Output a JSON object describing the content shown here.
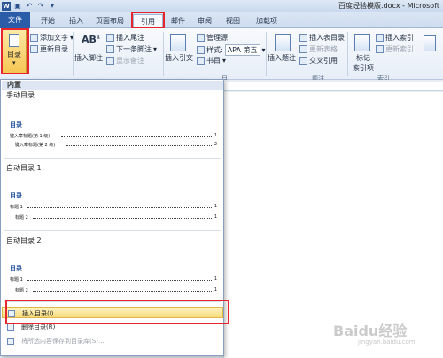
{
  "window": {
    "title": "百度经验模版.docx - Microsoft"
  },
  "tabs": [
    {
      "label": "文件"
    },
    {
      "label": "开始"
    },
    {
      "label": "插入"
    },
    {
      "label": "页面布局"
    },
    {
      "label": "引用"
    },
    {
      "label": "邮件"
    },
    {
      "label": "审阅"
    },
    {
      "label": "视图"
    },
    {
      "label": "加载项"
    }
  ],
  "ribbon": {
    "toc_button": "目录",
    "add_text": "添加文字",
    "update_toc": "更新目录",
    "insert_footnote": "插入脚注",
    "insert_endnote": "插入尾注",
    "next_footnote": "下一条脚注",
    "show_notes": "显示备注",
    "insert_citation": "插入引文",
    "manage_sources": "管理源",
    "style_label": "样式:",
    "style_value": "APA 第五",
    "bibliography": "书目",
    "insert_caption": "插入题注",
    "insert_table_of_figures": "插入表目录",
    "update_table": "更新表格",
    "cross_reference": "交叉引用",
    "mark_entry": "标记",
    "mark_entry_line2": "索引项",
    "insert_index": "插入索引",
    "update_index": "更新索引",
    "groups": {
      "toc": "目",
      "captions": "题注",
      "index": "索引"
    },
    "footnote_ab": "AB",
    "footnote_sup": "1"
  },
  "dropdown": {
    "header": "内置",
    "manual_title": "手动目录",
    "auto1_title": "自动目录 1",
    "auto2_title": "自动目录 2",
    "preview_heading": "目录",
    "manual_lines": [
      {
        "text": "键入章标题(第 1 级)",
        "page": "1"
      },
      {
        "text": "键入章标题(第 2 级)",
        "page": "2"
      }
    ],
    "auto_lines": [
      {
        "text": "标题 1",
        "page": "1"
      },
      {
        "text": "标题 2",
        "page": "1"
      }
    ],
    "menu": {
      "insert_toc": "插入目录(I)...",
      "remove_toc": "删除目录(R)",
      "save_selection": "将所选内容保存到目录库(S)..."
    }
  },
  "watermark": {
    "brand": "Baidu经验",
    "url": "jingyan.baidu.com"
  },
  "colors": {
    "highlight": "#e5262c",
    "file_tab": "#2a5ca8",
    "hover": "#f7dc7a"
  }
}
